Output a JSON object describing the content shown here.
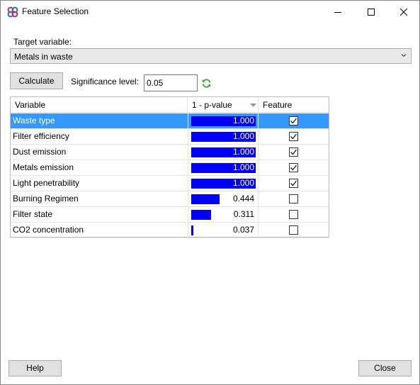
{
  "window": {
    "title": "Feature Selection",
    "icons": {
      "app": "app-logo-icon",
      "minimize": "minimize-icon",
      "maximize": "maximize-icon",
      "close": "close-icon"
    }
  },
  "target": {
    "label": "Target variable:",
    "selected": "Metals in waste",
    "dropdown_icon": "chevron-down-icon"
  },
  "controls": {
    "calculate_label": "Calculate",
    "significance_label": "Significance level:",
    "significance_value": "0.05",
    "refresh_icon": "refresh-icon"
  },
  "table": {
    "columns": [
      "Variable",
      "1 - p-value",
      "Feature"
    ],
    "sort_icon": "sort-descending-icon",
    "accent_bar_color": "#0000f5",
    "selection_color": "#3399ff",
    "rows": [
      {
        "variable": "Waste type",
        "pvalue": 1.0,
        "pvalue_text": "1.000",
        "feature": true,
        "selected": true
      },
      {
        "variable": "Filter efficiency",
        "pvalue": 1.0,
        "pvalue_text": "1.000",
        "feature": true,
        "selected": false
      },
      {
        "variable": "Dust emission",
        "pvalue": 1.0,
        "pvalue_text": "1.000",
        "feature": true,
        "selected": false
      },
      {
        "variable": "Metals emission",
        "pvalue": 1.0,
        "pvalue_text": "1.000",
        "feature": true,
        "selected": false
      },
      {
        "variable": "Light penetrability",
        "pvalue": 1.0,
        "pvalue_text": "1.000",
        "feature": true,
        "selected": false
      },
      {
        "variable": "Burning Regimen",
        "pvalue": 0.444,
        "pvalue_text": "0.444",
        "feature": false,
        "selected": false
      },
      {
        "variable": "Filter state",
        "pvalue": 0.311,
        "pvalue_text": "0.311",
        "feature": false,
        "selected": false
      },
      {
        "variable": "CO2 concentration",
        "pvalue": 0.037,
        "pvalue_text": "0.037",
        "feature": false,
        "selected": false
      }
    ]
  },
  "footer": {
    "help_label": "Help",
    "close_label": "Close"
  }
}
